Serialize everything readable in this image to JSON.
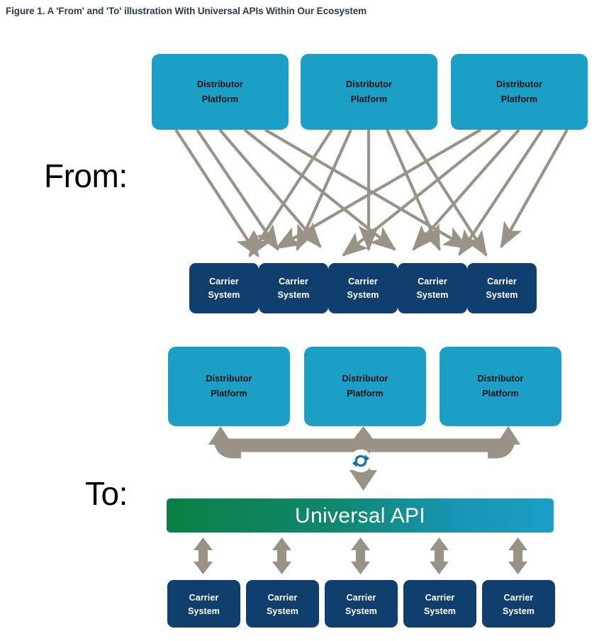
{
  "figure": {
    "caption": "Figure 1. A 'From' and 'To' illustration With Universal APIs Within Our Ecosystem"
  },
  "colors": {
    "distributor_blue": "#1B9FC6",
    "carrier_navy": "#103F6E",
    "connector_gray": "#9A9187",
    "api_gradient_start": "#0A8044",
    "api_gradient_end": "#1B9FC6",
    "sync_icon_blue": "#1A6FA8",
    "caption_text": "#2B3B4A",
    "page_background": "#FFFFFF"
  },
  "sections": [
    {
      "id": "from",
      "label": "From:",
      "distributors": [
        {
          "line1": "Distributor",
          "line2": "Platform"
        },
        {
          "line1": "Distributor",
          "line2": "Platform"
        },
        {
          "line1": "Distributor",
          "line2": "Platform"
        }
      ],
      "carriers": [
        {
          "line1": "Carrier",
          "line2": "System"
        },
        {
          "line1": "Carrier",
          "line2": "System"
        },
        {
          "line1": "Carrier",
          "line2": "System"
        },
        {
          "line1": "Carrier",
          "line2": "System"
        },
        {
          "line1": "Carrier",
          "line2": "System"
        }
      ],
      "connection_style": "point-to-point mesh, 15 one-way arrows from each distributor to every carrier"
    },
    {
      "id": "to",
      "label": "To:",
      "distributors": [
        {
          "line1": "Distributor",
          "line2": "Platform"
        },
        {
          "line1": "Distributor",
          "line2": "Platform"
        },
        {
          "line1": "Distributor",
          "line2": "Platform"
        }
      ],
      "hub": {
        "label": "Universal API",
        "icon": "sync-icon"
      },
      "carriers": [
        {
          "line1": "Carrier",
          "line2": "System"
        },
        {
          "line1": "Carrier",
          "line2": "System"
        },
        {
          "line1": "Carrier",
          "line2": "System"
        },
        {
          "line1": "Carrier",
          "line2": "System"
        },
        {
          "line1": "Carrier",
          "line2": "System"
        }
      ],
      "connection_style": "shared bus with bidirectional arrows through the Universal API hub"
    }
  ]
}
